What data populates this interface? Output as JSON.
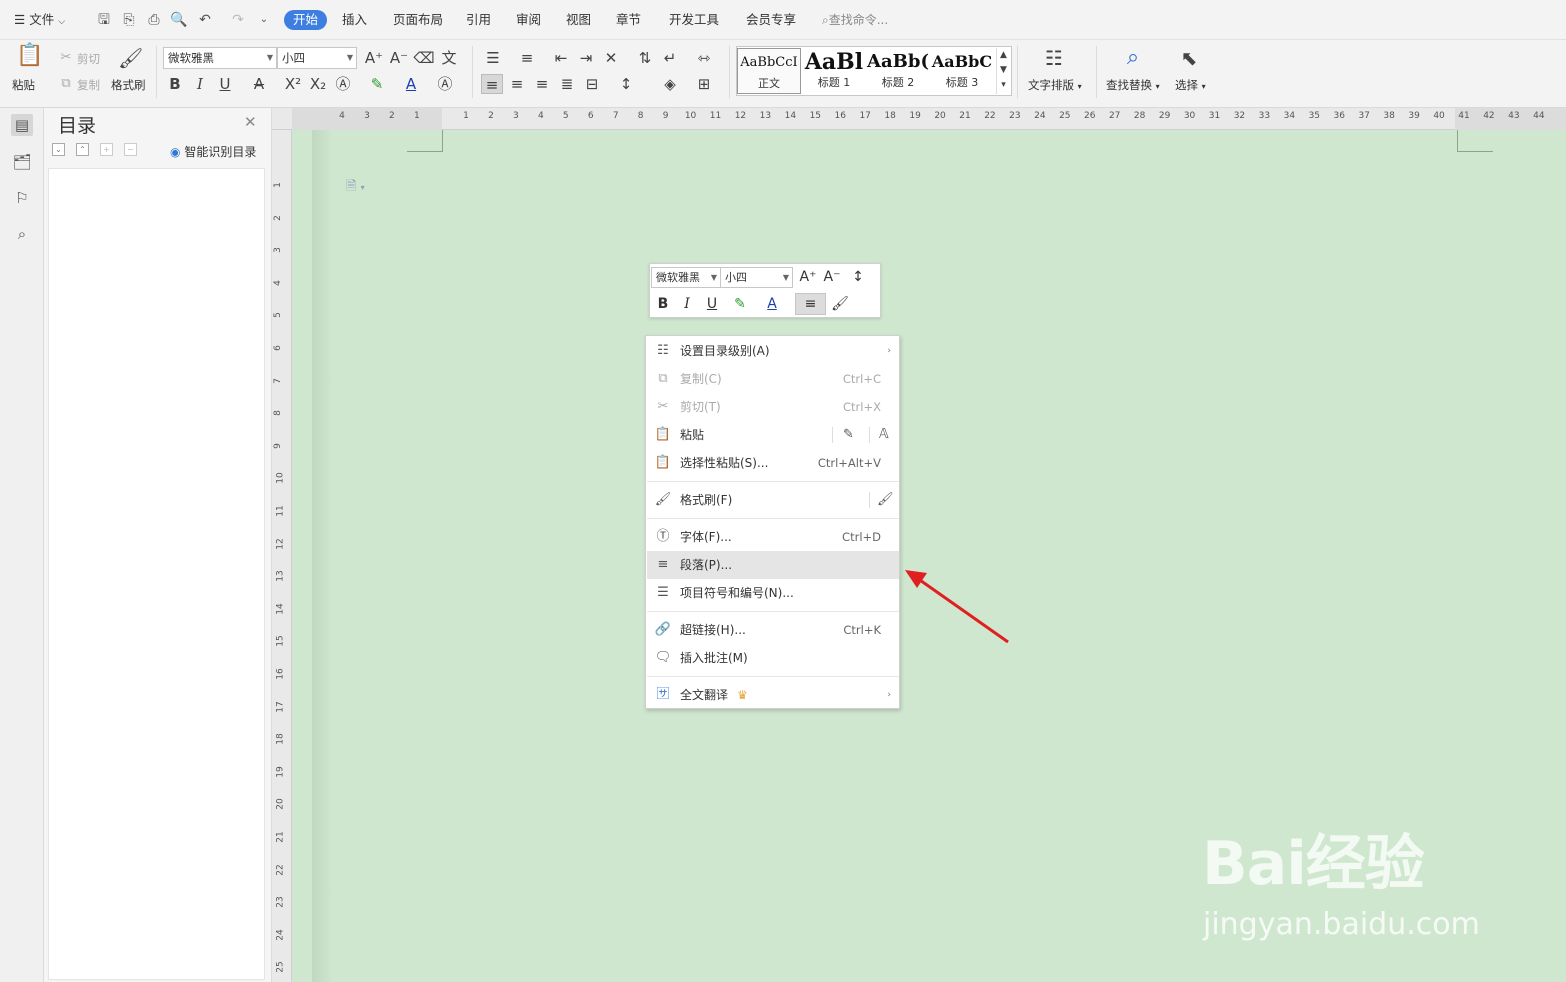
{
  "menubar": {
    "file_menu": "文件",
    "tabs": [
      {
        "label": "开始",
        "active": true
      },
      {
        "label": "插入"
      },
      {
        "label": "页面布局"
      },
      {
        "label": "引用"
      },
      {
        "label": "审阅"
      },
      {
        "label": "视图"
      },
      {
        "label": "章节"
      },
      {
        "label": "开发工具"
      },
      {
        "label": "会员专享"
      }
    ],
    "search_placeholder": "查找命令..."
  },
  "ribbon": {
    "paste": "粘贴",
    "cut": "剪切",
    "copy": "复制",
    "format_painter": "格式刷",
    "font_name": "微软雅黑",
    "font_size": "小四",
    "styles": [
      {
        "preview": "AaBbCcI",
        "label": "正文"
      },
      {
        "preview": "AaBl",
        "label": "标题 1"
      },
      {
        "preview": "AaBb(",
        "label": "标题 2"
      },
      {
        "preview": "AaBbC",
        "label": "标题 3"
      }
    ],
    "text_layout": "文字排版",
    "find_replace": "查找替换",
    "select": "选择"
  },
  "nav_pane": {
    "title": "目录",
    "smart_toc": "智能识别目录"
  },
  "ruler": {
    "h_ticks": [
      "4",
      "3",
      "2",
      "1",
      "1",
      "2",
      "3",
      "4",
      "5",
      "6",
      "7",
      "8",
      "9",
      "10",
      "11",
      "12",
      "13",
      "14",
      "15",
      "16",
      "17",
      "18",
      "19",
      "20",
      "21",
      "22",
      "23",
      "24",
      "25",
      "26",
      "27",
      "28",
      "29",
      "30",
      "31",
      "32",
      "33",
      "34",
      "35",
      "36",
      "37",
      "38",
      "39",
      "40",
      "41",
      "42",
      "43",
      "44"
    ],
    "v_ticks": [
      "1",
      "2",
      "3",
      "4",
      "5",
      "6",
      "7",
      "8",
      "9",
      "10",
      "11",
      "12",
      "13",
      "14",
      "15",
      "16",
      "17",
      "18",
      "19",
      "20",
      "21",
      "22",
      "23",
      "24",
      "25"
    ]
  },
  "mini_toolbar": {
    "font_name": "微软雅黑",
    "font_size": "小四"
  },
  "context_menu": {
    "items": [
      {
        "label": "设置目录级别(A)",
        "shortcut": "",
        "submenu": true
      },
      {
        "label": "复制(C)",
        "shortcut": "Ctrl+C",
        "disabled": true
      },
      {
        "label": "剪切(T)",
        "shortcut": "Ctrl+X",
        "disabled": true
      },
      {
        "label": "粘贴",
        "shortcut": ""
      },
      {
        "label": "选择性粘贴(S)...",
        "shortcut": "Ctrl+Alt+V"
      },
      {
        "label": "格式刷(F)",
        "shortcut": ""
      },
      {
        "label": "字体(F)...",
        "shortcut": "Ctrl+D"
      },
      {
        "label": "段落(P)...",
        "shortcut": "",
        "highlighted": true
      },
      {
        "label": "项目符号和编号(N)...",
        "shortcut": ""
      },
      {
        "label": "超链接(H)...",
        "shortcut": "Ctrl+K"
      },
      {
        "label": "插入批注(M)",
        "shortcut": ""
      },
      {
        "label": "全文翻译",
        "shortcut": "",
        "submenu": true
      }
    ]
  },
  "watermark": {
    "logo": "Bai经验",
    "url": "jingyan.baidu.com"
  },
  "colors": {
    "accent": "#3e7ee0",
    "doc_background": "#d0e7cf",
    "arrow": "#e02020"
  }
}
